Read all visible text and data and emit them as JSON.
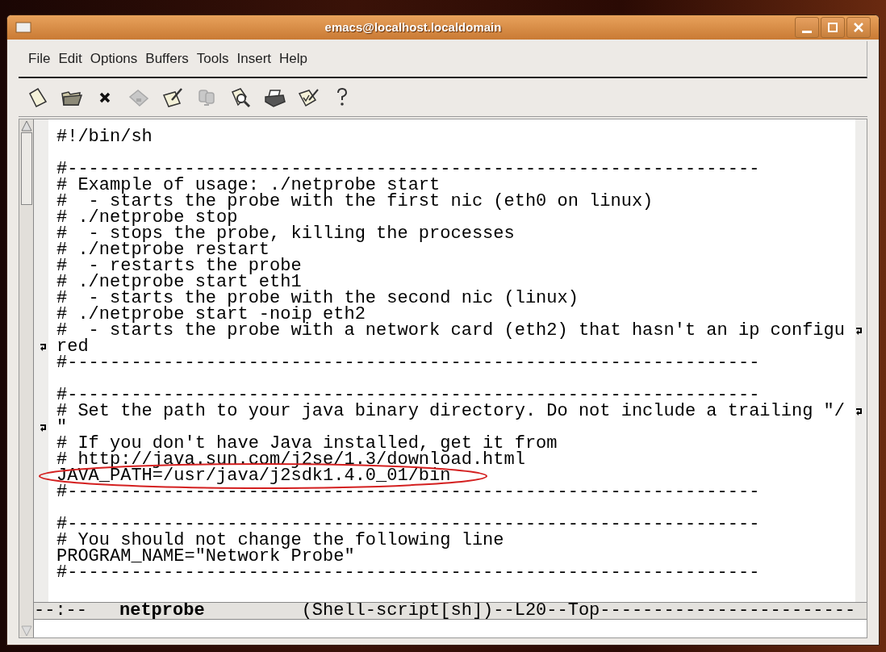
{
  "window": {
    "title": "emacs@localhost.localdomain"
  },
  "menu": [
    "File",
    "Edit",
    "Options",
    "Buffers",
    "Tools",
    "Insert",
    "Help"
  ],
  "toolbar": [
    {
      "kind": "new",
      "disabled": false
    },
    {
      "kind": "open",
      "disabled": false
    },
    {
      "kind": "close",
      "disabled": false
    },
    {
      "kind": "save",
      "disabled": true
    },
    {
      "kind": "save-as",
      "disabled": false
    },
    {
      "kind": "paste",
      "disabled": true
    },
    {
      "kind": "search",
      "disabled": false
    },
    {
      "kind": "print",
      "disabled": false
    },
    {
      "kind": "spell",
      "disabled": false
    },
    {
      "kind": "help",
      "disabled": false
    }
  ],
  "buffer": {
    "lines": [
      {
        "kind": "plain",
        "text": "#!/bin/sh"
      },
      {
        "kind": "blank"
      },
      {
        "kind": "plain",
        "text": "#-----------------------------------------------------------------"
      },
      {
        "kind": "plain",
        "text": "# Example of usage: ./netprobe start"
      },
      {
        "kind": "plain",
        "text": "#  - starts the probe with the first nic (eth0 on linux)"
      },
      {
        "kind": "plain",
        "text": "# ./netprobe stop"
      },
      {
        "kind": "plain",
        "text": "#  - stops the probe, killing the processes"
      },
      {
        "kind": "plain",
        "text": "# ./netprobe restart"
      },
      {
        "kind": "plain",
        "text": "#  - restarts the probe"
      },
      {
        "kind": "plain",
        "text": "# ./netprobe start eth1"
      },
      {
        "kind": "plain",
        "text": "#  - starts the probe with the second nic (linux)"
      },
      {
        "kind": "plain",
        "text": "# ./netprobe start -noip eth2"
      },
      {
        "kind": "wrapped",
        "text": "#  - starts the probe with a network card (eth2) that hasn't an ip configu"
      },
      {
        "kind": "continuation",
        "text": "red"
      },
      {
        "kind": "plain",
        "text": "#-----------------------------------------------------------------"
      },
      {
        "kind": "blank"
      },
      {
        "kind": "plain",
        "text": "#-----------------------------------------------------------------"
      },
      {
        "kind": "wrapped",
        "text": "# Set the path to your java binary directory. Do not include a trailing \"/"
      },
      {
        "kind": "continuation",
        "text": "\""
      },
      {
        "kind": "plain",
        "text": "# If you don't have Java installed, get it from"
      },
      {
        "kind": "plain",
        "text": "# http://java.sun.com/j2se/1.3/download.html"
      },
      {
        "kind": "plain",
        "text": "JAVA_PATH=/usr/java/j2sdk1.4.0_01/bin",
        "highlighted": true
      },
      {
        "kind": "plain",
        "text": "#-----------------------------------------------------------------"
      },
      {
        "kind": "blank"
      },
      {
        "kind": "plain",
        "text": "#-----------------------------------------------------------------"
      },
      {
        "kind": "plain",
        "text": "# You should not change the following line"
      },
      {
        "kind": "plain",
        "text": "PROGRAM_NAME=\"Network Probe\""
      },
      {
        "kind": "plain",
        "text": "#-----------------------------------------------------------------"
      }
    ]
  },
  "mode_line": {
    "status": "--:--",
    "buffer_name": "netprobe",
    "mode": "(Shell-script[sh])--L20--Top------------------------"
  }
}
